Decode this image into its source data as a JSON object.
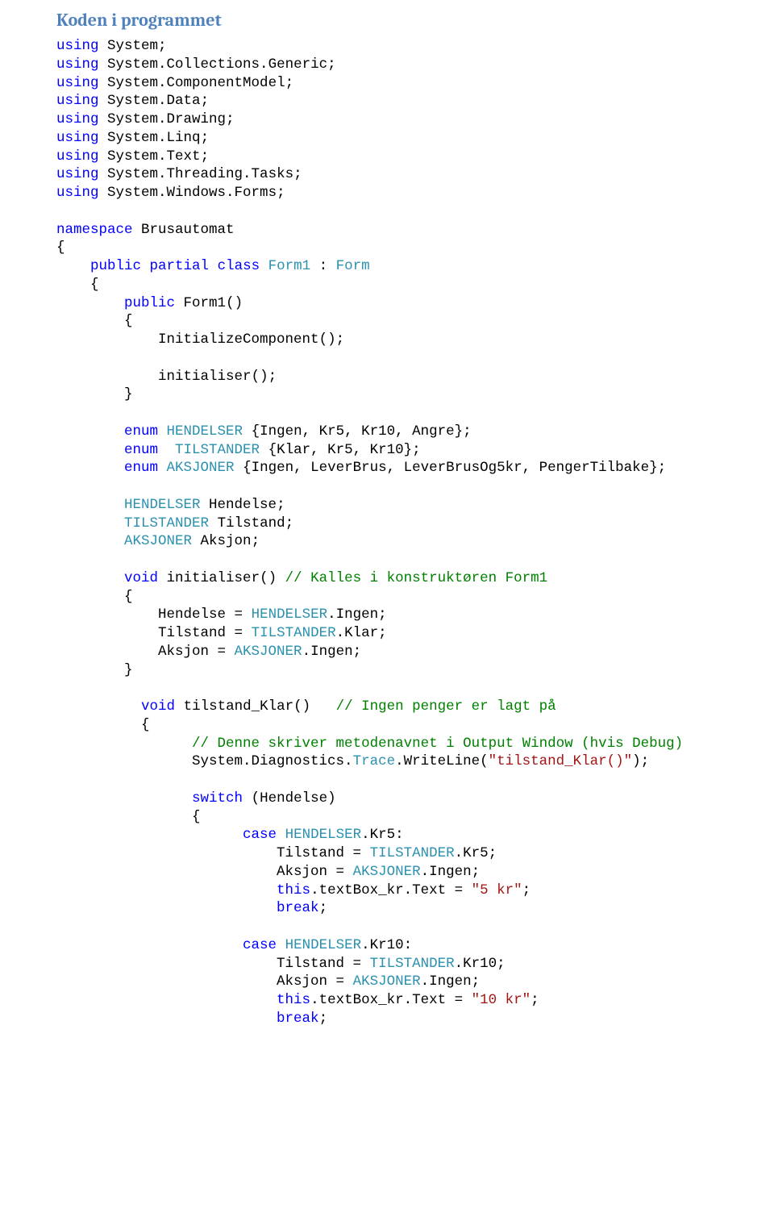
{
  "title": "Koden i programmet",
  "using": [
    "System",
    "System.Collections.Generic",
    "System.ComponentModel",
    "System.Data",
    "System.Drawing",
    "System.Linq",
    "System.Text",
    "System.Threading.Tasks",
    "System.Windows.Forms"
  ],
  "namespace": "Brusautomat",
  "access": "public",
  "partial": "partial",
  "classKw": "class",
  "className": "Form1",
  "baseClass": "Form",
  "ctor": "Form1",
  "initComp": "InitializeComponent",
  "initialiserCall": "initialiser",
  "enumKw": "enum",
  "enum1": {
    "name": "HENDELSER",
    "members": "{Ingen, Kr5, Kr10, Angre}"
  },
  "enum2": {
    "name": "TILSTANDER",
    "members": "{Klar, Kr5, Kr10}"
  },
  "enum3": {
    "name": "AKSJONER",
    "members": "{Ingen, LeverBrus, LeverBrusOg5kr, PengerTilbake}"
  },
  "field1": {
    "type": "HENDELSER",
    "name": "Hendelse"
  },
  "field2": {
    "type": "TILSTANDER",
    "name": "Tilstand"
  },
  "field3": {
    "type": "AKSJONER",
    "name": "Aksjon"
  },
  "voidKw": "void",
  "initialiser": "initialiser",
  "comment1": "// Kalles i konstruktøren Form1",
  "initBody1": {
    "lhs": "Hendelse = ",
    "type": "HENDELSER",
    "rhs": ".Ingen;"
  },
  "initBody2": {
    "lhs": "Tilstand = ",
    "type": "TILSTANDER",
    "rhs": ".Klar;"
  },
  "initBody3": {
    "lhs": "Aksjon = ",
    "type": "AKSJONER",
    "rhs": ".Ingen;"
  },
  "tilstandKlar": "tilstand_Klar",
  "comment2": "// Ingen penger er lagt på",
  "comment3": "// Denne skriver metodenavnet i Output Window (hvis Debug)",
  "trace": {
    "p1": "System.Diagnostics.",
    "p2": "Trace",
    "p3": ".WriteLine(",
    "str": "\"tilstand_Klar()\"",
    "p4": ");"
  },
  "switchKw": "switch",
  "switchVar": "(Hendelse)",
  "caseKw": "case",
  "breakKw": "break",
  "thisKw": "this",
  "case1": {
    "type": "HENDELSER",
    "member": ".Kr5:",
    "l1a": "Tilstand = ",
    "l1t": "TILSTANDER",
    "l1b": ".Kr5;",
    "l2a": "Aksjon = ",
    "l2t": "AKSJONER",
    "l2b": ".Ingen;",
    "l3a": ".textBox_kr.Text = ",
    "l3s": "\"5 kr\"",
    "l3b": ";"
  },
  "case2": {
    "type": "HENDELSER",
    "member": ".Kr10:",
    "l1a": "Tilstand = ",
    "l1t": "TILSTANDER",
    "l1b": ".Kr10;",
    "l2a": "Aksjon = ",
    "l2t": "AKSJONER",
    "l2b": ".Ingen;",
    "l3a": ".textBox_kr.Text = ",
    "l3s": "\"10 kr\"",
    "l3b": ";"
  },
  "kw": {
    "using": "using",
    "namespace": "namespace"
  }
}
